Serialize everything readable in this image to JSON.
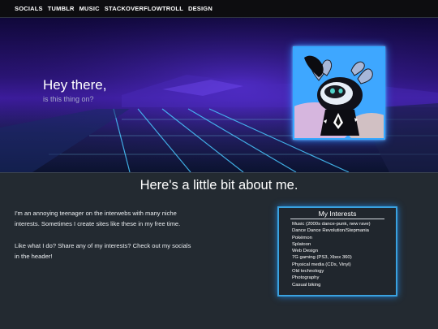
{
  "nav": {
    "items": [
      {
        "label": "SOCIALS"
      },
      {
        "label": "TUMBLR"
      },
      {
        "label": "MUSIC"
      },
      {
        "label": "STACKOVERFLOWTROLL"
      },
      {
        "label": "DESIGN"
      }
    ]
  },
  "hero": {
    "title": "Hey there,",
    "subtitle": "is this thing on?"
  },
  "about": {
    "heading": "Here's a little bit about me.",
    "paragraphs": [
      "I'm an annoying teenager on the interwebs with many niche interests. Sometimes I create sites like these in my free time.",
      "Like what I do? Share any of my interests? Check out my socials in the header!"
    ]
  },
  "interests": {
    "title": "My Interests",
    "items": [
      "Music (2000s dance-punk, new rave)",
      "Dance Dance Revolution/Stepmania",
      "Pokémon",
      "Splatoon",
      "Web Design",
      "7G gaming (PS3, Xbox 360)",
      "Physical media (CDs, Vinyl)",
      "Old technology",
      "Photography",
      "Casual biking"
    ]
  },
  "colors": {
    "accent_glow": "#36a8ff",
    "hero_purple": "#3d1c9e",
    "page_bg": "#232a31"
  }
}
